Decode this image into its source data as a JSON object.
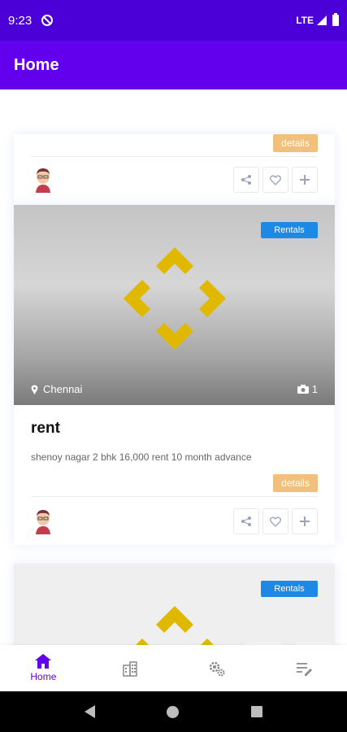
{
  "status_bar": {
    "time": "9:23",
    "network": "LTE"
  },
  "app_bar": {
    "title": "Home"
  },
  "cards": [
    {
      "details_label": "details"
    },
    {
      "badge": "Rentals",
      "location": "Chennai",
      "photo_count": "1",
      "title": "rent",
      "description": "shenoy nagar 2 bhk 16,000 rent 10 month advance",
      "details_label": "details"
    },
    {
      "badge": "Rentals"
    }
  ],
  "bottom_nav": {
    "items": [
      {
        "label": "Home",
        "icon": "home-icon",
        "active": true
      },
      {
        "label": "",
        "icon": "building-icon"
      },
      {
        "label": "",
        "icon": "settings-gears-icon"
      },
      {
        "label": "",
        "icon": "edit-list-icon"
      }
    ]
  },
  "colors": {
    "status_bar": "#4a00d6",
    "app_bar": "#6200ee",
    "badge": "#1e88e5",
    "details": "#f2c07d",
    "logo": "#e0b800"
  }
}
